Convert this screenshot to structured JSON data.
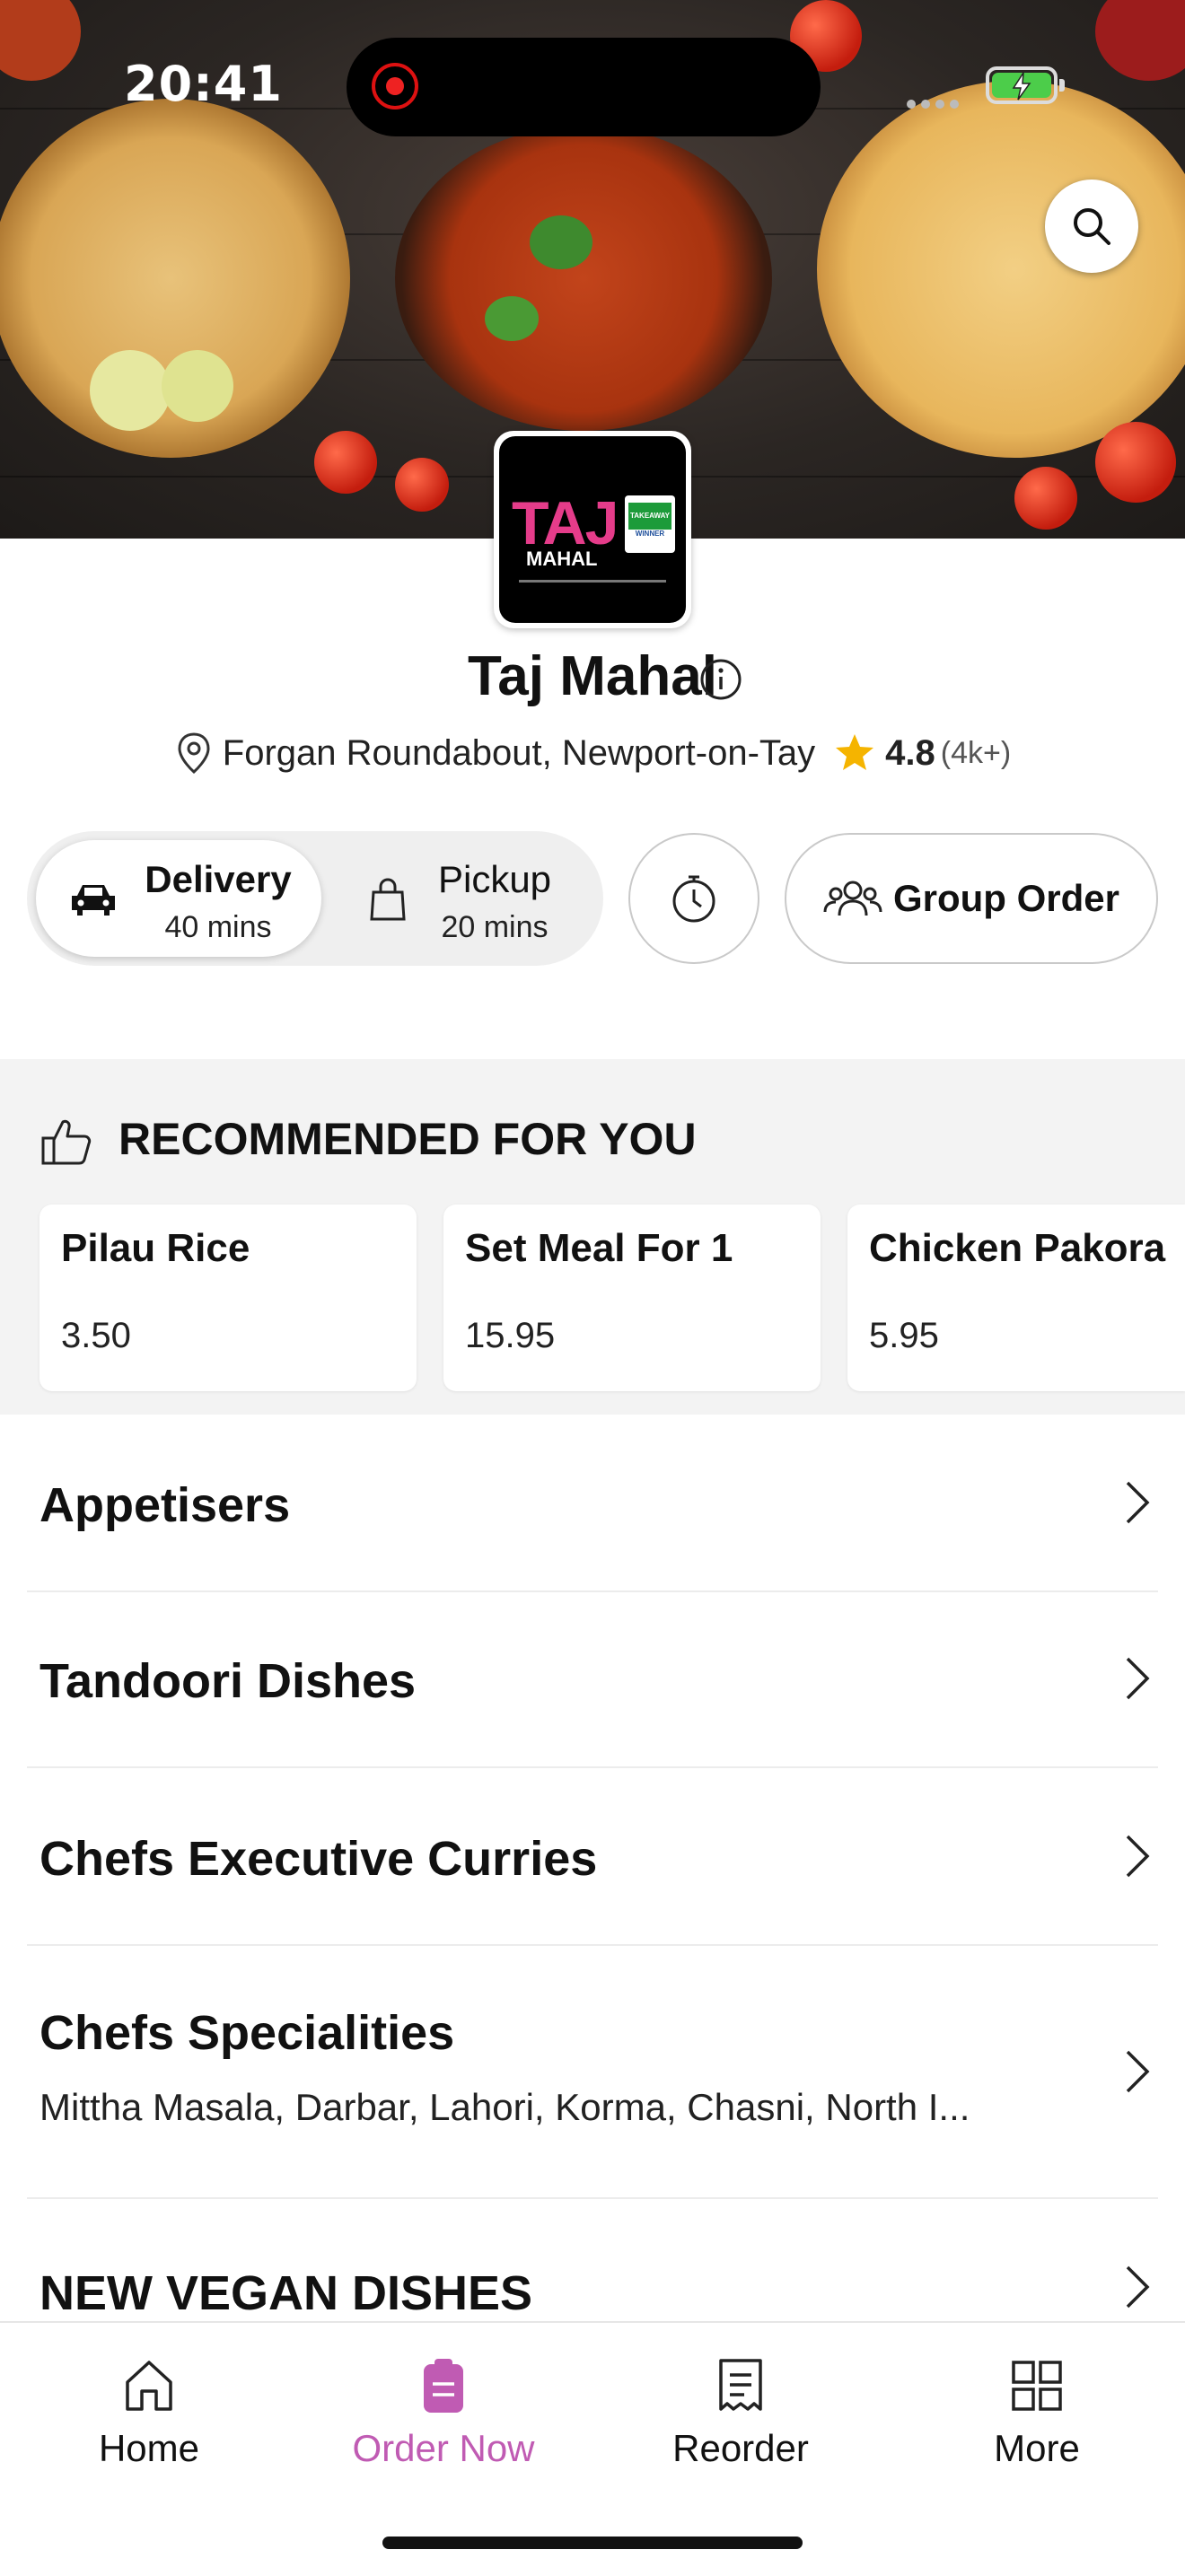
{
  "status_bar": {
    "time": "20:41"
  },
  "restaurant": {
    "name": "Taj Mahal",
    "address": "Forgan Roundabout, Newport-on-Tay",
    "rating": "4.8",
    "rating_count": "(4k+)",
    "logo": {
      "word": "TAJ",
      "sub": "MAHAL",
      "badge": "TAKEAWAY",
      "badge_sub": "WINNER"
    }
  },
  "order_modes": {
    "delivery": {
      "label": "Delivery",
      "time": "40 mins"
    },
    "pickup": {
      "label": "Pickup",
      "time": "20 mins"
    }
  },
  "group_order_label": "Group Order",
  "recommended": {
    "title": "RECOMMENDED FOR YOU",
    "items": [
      {
        "name": "Pilau Rice",
        "price": "3.50"
      },
      {
        "name": "Set Meal For 1",
        "price": "15.95"
      },
      {
        "name": "Chicken Pakora",
        "price": "5.95"
      }
    ]
  },
  "categories": [
    {
      "name": "Appetisers"
    },
    {
      "name": "Tandoori Dishes"
    },
    {
      "name": "Chefs Executive Curries"
    },
    {
      "name": "Chefs Specialities",
      "subtitle": "Mittha Masala, Darbar, Lahori, Korma, Chasni, North I..."
    },
    {
      "name": "NEW VEGAN DISHES"
    }
  ],
  "tabs": [
    {
      "label": "Home",
      "icon": "home-icon"
    },
    {
      "label": "Order Now",
      "icon": "order-icon",
      "active": true
    },
    {
      "label": "Reorder",
      "icon": "receipt-icon"
    },
    {
      "label": "More",
      "icon": "grid-icon"
    }
  ],
  "colors": {
    "accent": "#c05bb3",
    "star": "#f5b400",
    "battery": "#4ccd4a"
  }
}
